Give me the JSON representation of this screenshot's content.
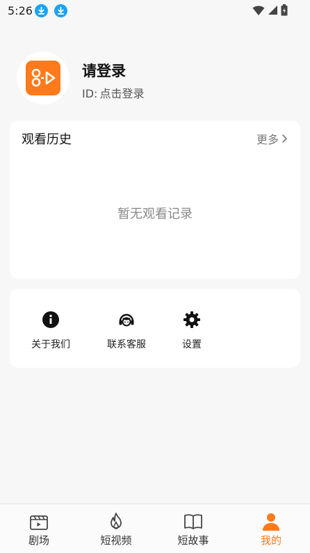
{
  "status_bar": {
    "time": "5:26"
  },
  "profile": {
    "title": "请登录",
    "id_prefix": "ID:",
    "id_action": "点击登录"
  },
  "history": {
    "title": "观看历史",
    "more_label": "更多",
    "empty_text": "暂无观看记录"
  },
  "menu": {
    "items": [
      {
        "label": "关于我们",
        "icon": "info-icon"
      },
      {
        "label": "联系客服",
        "icon": "headset-icon"
      },
      {
        "label": "设置",
        "icon": "gear-icon"
      }
    ]
  },
  "bottom_nav": {
    "active_color": "#ff7a1a",
    "items": [
      {
        "label": "剧场",
        "icon": "theater-icon"
      },
      {
        "label": "短视频",
        "icon": "flame-icon"
      },
      {
        "label": "短故事",
        "icon": "book-icon"
      },
      {
        "label": "我的",
        "icon": "person-icon",
        "active": true
      }
    ]
  }
}
